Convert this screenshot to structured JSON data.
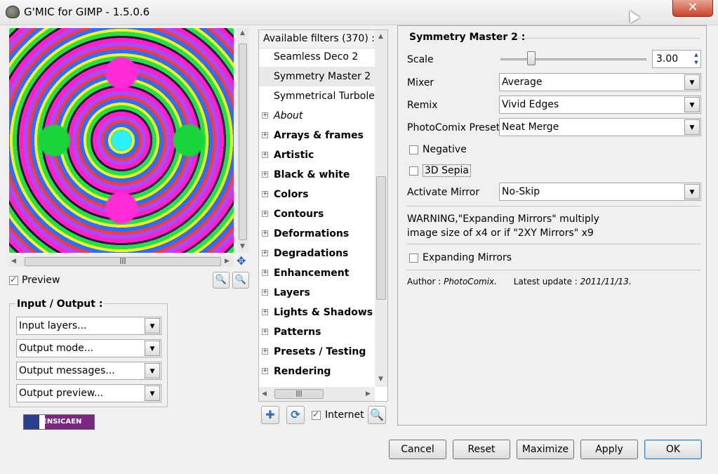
{
  "window": {
    "title": "G'MIC for GIMP - 1.5.0.6",
    "close_glyph": "✕"
  },
  "preview_panel": {
    "preview_label": "Preview",
    "preview_checked": true,
    "zoom_out_icon": "zoom-out-icon",
    "zoom_in_icon": "zoom-in-icon"
  },
  "io": {
    "title": "Input / Output :",
    "combos": [
      {
        "value": "Input layers..."
      },
      {
        "value": "Output mode..."
      },
      {
        "value": "Output messages..."
      },
      {
        "value": "Output preview..."
      }
    ],
    "logo_text": "ENSICAEN"
  },
  "filters": {
    "header": "Available filters (370) :",
    "items": [
      {
        "label": "Seamless Deco 2",
        "kind": "leaf"
      },
      {
        "label": "Symmetry Master 2",
        "kind": "leaf",
        "selected": true
      },
      {
        "label": "Symmetrical Turbolence",
        "kind": "leaf"
      },
      {
        "label": "About",
        "kind": "group-italic"
      },
      {
        "label": "Arrays & frames",
        "kind": "group"
      },
      {
        "label": "Artistic",
        "kind": "group"
      },
      {
        "label": "Black & white",
        "kind": "group"
      },
      {
        "label": "Colors",
        "kind": "group"
      },
      {
        "label": "Contours",
        "kind": "group"
      },
      {
        "label": "Deformations",
        "kind": "group"
      },
      {
        "label": "Degradations",
        "kind": "group"
      },
      {
        "label": "Enhancement",
        "kind": "group"
      },
      {
        "label": "Layers",
        "kind": "group"
      },
      {
        "label": "Lights & Shadows",
        "kind": "group"
      },
      {
        "label": "Patterns",
        "kind": "group"
      },
      {
        "label": "Presets / Testing",
        "kind": "group"
      },
      {
        "label": "Rendering",
        "kind": "group"
      }
    ],
    "internet_label": "Internet",
    "internet_checked": true
  },
  "params": {
    "title": "Symmetry Master 2 :",
    "scale_label": "Scale",
    "scale_value": "3.00",
    "mixer_label": "Mixer",
    "mixer_value": "Average",
    "remix_label": "Remix",
    "remix_value": "Vivid Edges",
    "preset_label": "PhotoComix Preset",
    "preset_value": "Neat Merge",
    "negative_label": "Negative",
    "sepia_label": "3D Sepia",
    "mirror_label": "Activate Mirror",
    "mirror_value": "No-Skip",
    "warning_line1": "WARNING,\"Expanding Mirrors\" multiply",
    "warning_line2": "image size of x4 or if \"2XY Mirrors\" x9",
    "expanding_label": "Expanding Mirrors",
    "author_prefix": "Author : ",
    "author_name": "PhotoComix.",
    "update_prefix": "Latest update : ",
    "update_date": "2011/11/13."
  },
  "buttons": {
    "cancel": "Cancel",
    "reset": "Reset",
    "maximize": "Maximize",
    "apply": "Apply",
    "ok": "OK"
  }
}
